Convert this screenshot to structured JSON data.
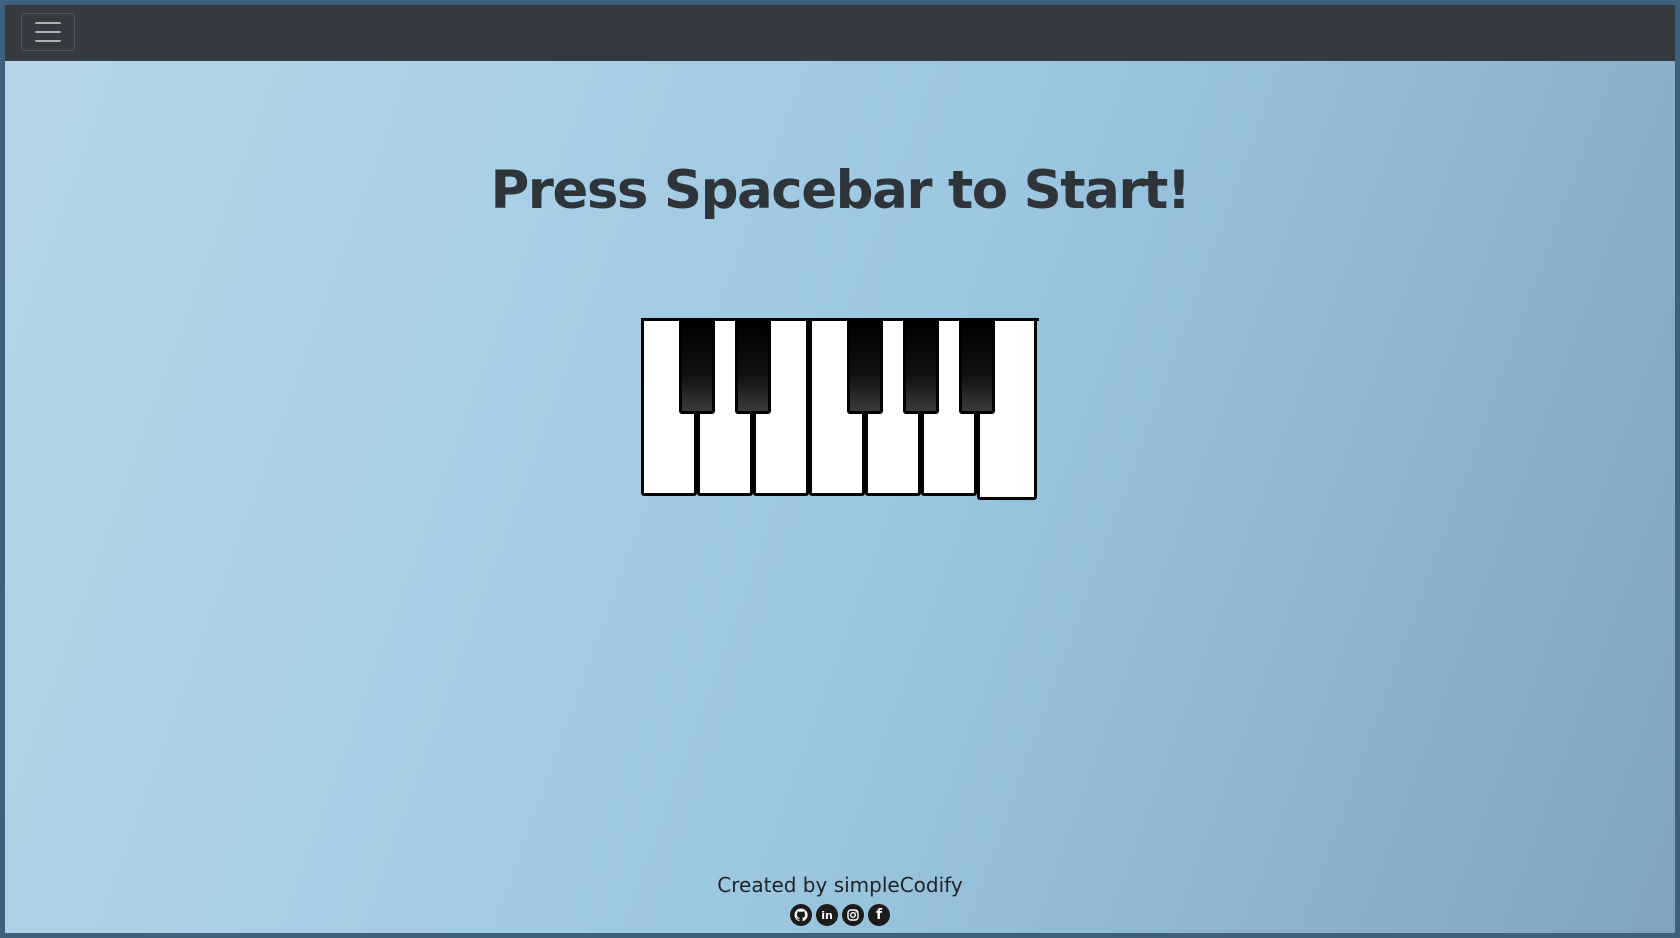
{
  "navbar": {
    "toggler_icon": "hamburger-menu-icon"
  },
  "main": {
    "headline": "Press Spacebar to Start!"
  },
  "piano": {
    "white_keys": 7,
    "black_keys": 5
  },
  "footer": {
    "credit": "Created by simpleCodify",
    "socials": [
      {
        "name": "github-icon",
        "glyph": ""
      },
      {
        "name": "linkedin-icon",
        "glyph": "in"
      },
      {
        "name": "instagram-icon",
        "glyph": ""
      },
      {
        "name": "facebook-icon",
        "glyph": "f"
      }
    ]
  },
  "colors": {
    "navbar": "#343a40",
    "headline": "#2f3438",
    "background_start": "#b6d7e8",
    "background_end": "#7ea5bd"
  }
}
